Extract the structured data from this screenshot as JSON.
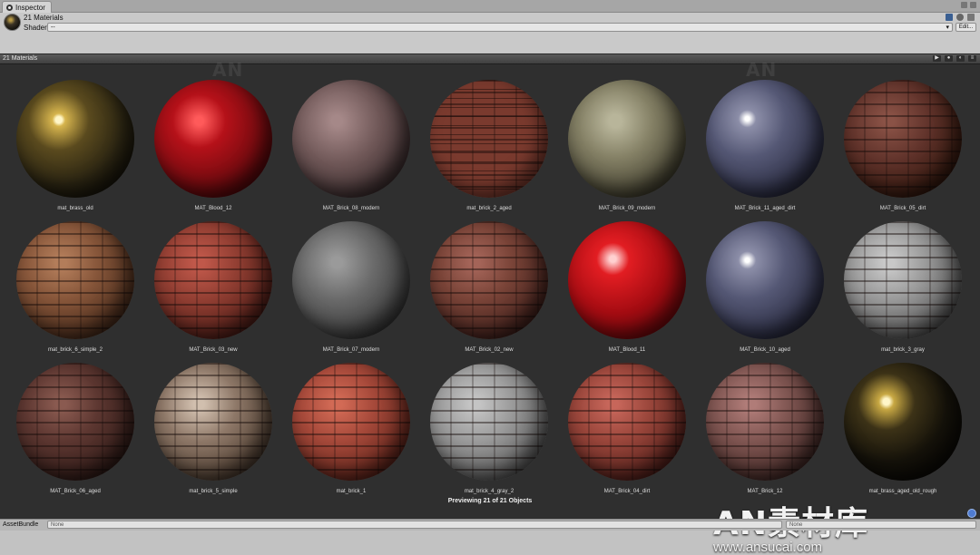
{
  "tab": {
    "label": "Inspector"
  },
  "header": {
    "title": "21 Materials",
    "shader_label": "Shader",
    "shader_value": "--",
    "edit_label": "Edit..."
  },
  "preview": {
    "title": "21 Materials",
    "status": "Previewing 21 of 21 Objects",
    "materials": [
      {
        "name": "mat_brass_old",
        "kind": "brass"
      },
      {
        "name": "MAT_Blood_12",
        "kind": "blood"
      },
      {
        "name": "MAT_Brick_08_modern",
        "kind": "stone_mauve"
      },
      {
        "name": "mat_brick_2_aged",
        "kind": "brick_red"
      },
      {
        "name": "MAT_Brick_09_modern",
        "kind": "rock_green"
      },
      {
        "name": "MAT_Brick_11_aged_dirt",
        "kind": "tile_blue"
      },
      {
        "name": "MAT_Brick_05_dirt",
        "kind": "brick_dirt"
      },
      {
        "name": "mat_brick_6_simple_2",
        "kind": "brick_tan"
      },
      {
        "name": "MAT_Brick_03_new",
        "kind": "brick_new"
      },
      {
        "name": "MAT_Brick_07_modern",
        "kind": "rock_grey"
      },
      {
        "name": "MAT_Brick_02_new",
        "kind": "brick_smooth"
      },
      {
        "name": "MAT_Blood_11",
        "kind": "blood_glossy"
      },
      {
        "name": "MAT_Brick_10_aged",
        "kind": "tile_blue"
      },
      {
        "name": "mat_brick_3_gray",
        "kind": "brick_grey"
      },
      {
        "name": "MAT_Brick_06_aged",
        "kind": "brick_dark"
      },
      {
        "name": "mat_brick_5_simple",
        "kind": "brick_light"
      },
      {
        "name": "mat_brick_1",
        "kind": "brick_orange"
      },
      {
        "name": "mat_brick_4_gray_2",
        "kind": "brick_grey2"
      },
      {
        "name": "MAT_Brick_04_dirt",
        "kind": "brick_red2"
      },
      {
        "name": "MAT_Brick_12",
        "kind": "brick_mauve"
      },
      {
        "name": "mat_brass_aged_old_rough",
        "kind": "brass_dark"
      }
    ]
  },
  "watermark": {
    "logo": "AN素材库",
    "url": "www.ansucai.com",
    "small": "AN"
  },
  "bottom": {
    "assetbundle_label": "AssetBundle",
    "assetbundle_value": "None",
    "variant_value": "None"
  }
}
